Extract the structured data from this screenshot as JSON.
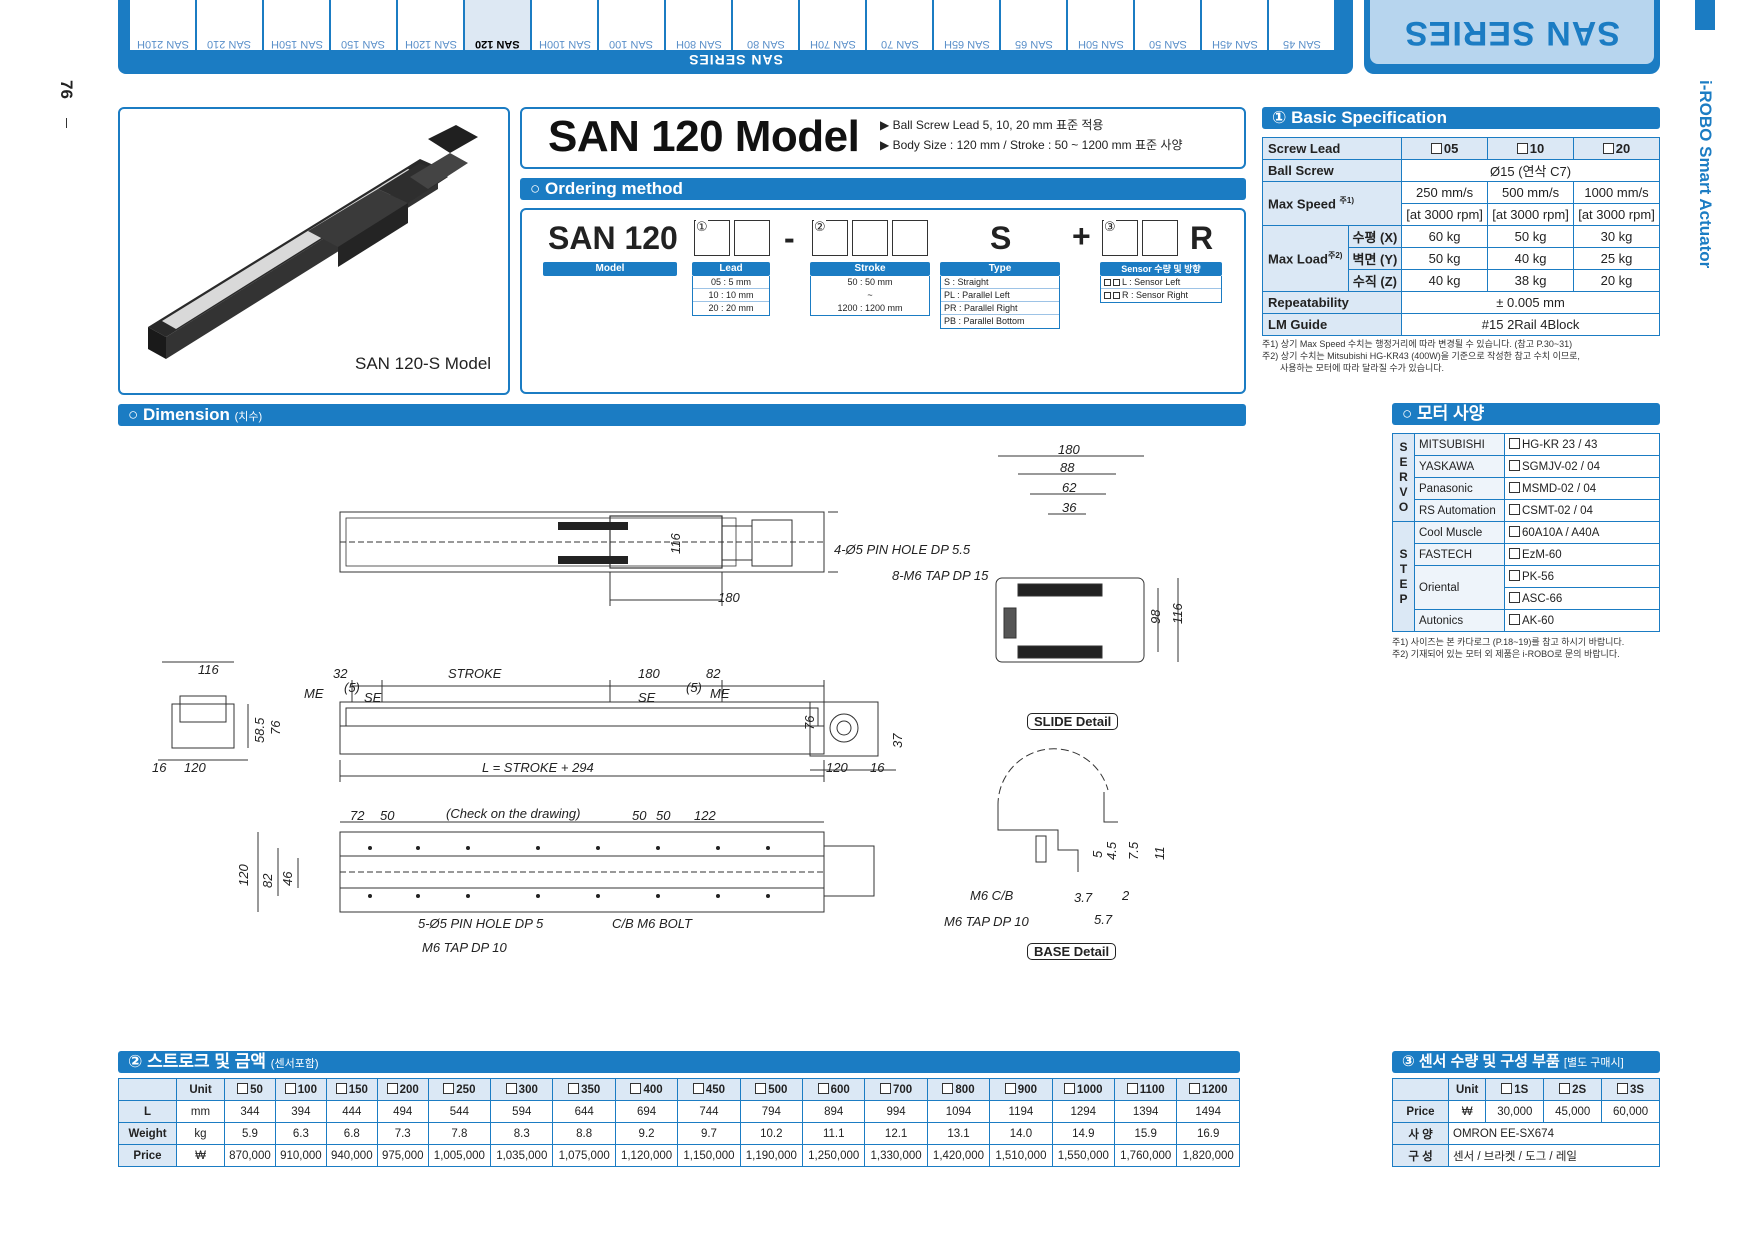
{
  "page_number": "76",
  "brand_vertical": "i-ROBO Smart Actuator",
  "series_box": "SAN SERIES",
  "top_tabs": {
    "label": "SAN SERIES",
    "items": [
      "SAN 210H",
      "SAN 210",
      "SAN 150H",
      "SAN 150",
      "SAN 120H",
      "SAN 120",
      "SAN 100H",
      "SAN 100",
      "SAN 80H",
      "SAN 80",
      "SAN 70H",
      "SAN 70",
      "SAN 65H",
      "SAN 65",
      "SAN 50H",
      "SAN 50",
      "SAN 45H",
      "SAN 45"
    ],
    "active_index": 5
  },
  "product_image_caption": "SAN 120-S Model",
  "model": {
    "title": "SAN 120 Model",
    "notes": [
      "▶ Ball Screw Lead 5, 10, 20 mm 표준 적용",
      "▶ Body Size : 120 mm / Stroke : 50 ~ 1200 mm 표준 사양"
    ]
  },
  "ordering": {
    "title": "○ Ordering method",
    "code": "SAN 120",
    "dash": "-",
    "type_letter": "S",
    "plus": "+",
    "suffix": "R",
    "circled": [
      "①",
      "②",
      "③"
    ],
    "labels": {
      "model": "Model",
      "lead": "Lead",
      "stroke": "Stroke",
      "type": "Type",
      "sensor": "Sensor 수량 및 방향"
    },
    "lead_options": [
      "05 : 5 mm",
      "10 : 10 mm",
      "20 : 20 mm"
    ],
    "stroke_options": [
      "50 : 50 mm",
      "~",
      "1200 : 1200 mm"
    ],
    "type_options": [
      "S : Straight",
      "PL : Parallel Left",
      "PR : Parallel Right",
      "PB : Parallel Bottom"
    ],
    "sensor_options": [
      "L : Sensor Left",
      "R : Sensor Right"
    ]
  },
  "basic_spec": {
    "title": "① Basic Specification",
    "rows": {
      "screw_lead": "Screw Lead",
      "leads": [
        "05",
        "10",
        "20"
      ],
      "ball_screw": "Ball Screw",
      "ball_screw_val": "Ø15 (연삭 C7)",
      "max_speed": "Max Speed",
      "max_speed_note": "주1)",
      "speeds": [
        "250 mm/s",
        "500 mm/s",
        "1000 mm/s"
      ],
      "rpm": [
        "[at 3000 rpm]",
        "[at 3000 rpm]",
        "[at 3000 rpm]"
      ],
      "max_load": "Max Load",
      "max_load_note": "주2)",
      "load_rows": [
        {
          "label": "수평 (X)",
          "vals": [
            "60 kg",
            "50 kg",
            "30 kg"
          ]
        },
        {
          "label": "벽면 (Y)",
          "vals": [
            "50 kg",
            "40 kg",
            "25 kg"
          ]
        },
        {
          "label": "수직 (Z)",
          "vals": [
            "40 kg",
            "38 kg",
            "20 kg"
          ]
        }
      ],
      "repeatability": "Repeatability",
      "repeatability_val": "± 0.005 mm",
      "lm_guide": "LM Guide",
      "lm_guide_val": "#15 2Rail 4Block"
    },
    "footnotes": [
      "주1) 상기 Max Speed 수치는 행정거리에 따라 변경될 수 있습니다. (참고 P.30~31)",
      "주2) 상기 수치는 Mitsubishi HG-KR43 (400W)을 기준으로 작성한 참고 수치 이므로,",
      "사용하는 모터에 따라 달라질 수가 있습니다."
    ]
  },
  "motor_spec": {
    "title": "○ 모터 사양",
    "servo_label": [
      "S",
      "E",
      "R",
      "V",
      "O"
    ],
    "step_label": [
      "S",
      "T",
      "E",
      "P"
    ],
    "servo": [
      {
        "maker": "MITSUBISHI",
        "model": "HG-KR 23 / 43"
      },
      {
        "maker": "YASKAWA",
        "model": "SGMJV-02 / 04"
      },
      {
        "maker": "Panasonic",
        "model": "MSMD-02 / 04"
      },
      {
        "maker": "RS Automation",
        "model": "CSMT-02 / 04"
      }
    ],
    "step": [
      {
        "maker": "Cool Muscle",
        "model": "60A10A / A40A"
      },
      {
        "maker": "FASTECH",
        "model": "EzM-60"
      },
      {
        "maker": "Oriental",
        "model": "PK-56"
      },
      {
        "maker": "",
        "model": "ASC-66"
      },
      {
        "maker": "Autonics",
        "model": "AK-60"
      }
    ],
    "footnotes": [
      "주1) 사이즈는 본 카다로그 (P.18~19)를 참고 하시기 바랍니다.",
      "주2) 기재되어 있는 모터 외 제품은 i-ROBO로 문의 바랍니다."
    ]
  },
  "dimension": {
    "title": "○ Dimension",
    "title_small": "(치수)",
    "labels": {
      "pin_hole_top": "4-Ø5 PIN HOLE DP 5.5",
      "tap_top": "8-M6 TAP DP 15",
      "stroke": "STROKE",
      "me": "ME",
      "se": "SE",
      "five": "(5)",
      "l_formula": "L = STROKE + 294",
      "check": "(Check on the drawing)",
      "pin_hole_bottom": "5-Ø5 PIN HOLE DP 5",
      "cb_bolt": "C/B M6 BOLT",
      "tap_bottom": "M6 TAP DP 10",
      "m6cb": "M6 C/B",
      "m6tap": "M6 TAP DP 10"
    },
    "numbers": {
      "top_116": "116",
      "top_180": "180",
      "side_32": "32",
      "side_180": "180",
      "side_82": "82",
      "end_116": "116",
      "end_76": "76",
      "end_58": "58.5",
      "end_16": "16",
      "end_120": "120",
      "end2_76": "76",
      "end2_37": "37",
      "end2_120": "120",
      "end2_16": "16",
      "slide_180": "180",
      "slide_88": "88",
      "slide_62": "62",
      "slide_36": "36",
      "slide_98": "98",
      "slide_116": "116",
      "bot_72": "72",
      "bot_50a": "50",
      "bot_50b": "50",
      "bot_50c": "50",
      "bot_122": "122",
      "bot_120": "120",
      "bot_82": "82",
      "bot_46": "46",
      "base_11": "11",
      "base_7": "7.5",
      "base_45": "4.5",
      "base_5": "5",
      "base_37": "3.7",
      "base_2": "2",
      "base_57": "5.7"
    },
    "slide_detail": "SLIDE Detail",
    "base_detail": "BASE Detail"
  },
  "price_table": {
    "title": "② 스트로크 및 금액",
    "title_small": "(센서포함)",
    "unit_header": "Unit",
    "strokes": [
      "50",
      "100",
      "150",
      "200",
      "250",
      "300",
      "350",
      "400",
      "450",
      "500",
      "600",
      "700",
      "800",
      "900",
      "1000",
      "1100",
      "1200"
    ],
    "rows": [
      {
        "label": "L",
        "unit": "mm",
        "vals": [
          "344",
          "394",
          "444",
          "494",
          "544",
          "594",
          "644",
          "694",
          "744",
          "794",
          "894",
          "994",
          "1094",
          "1194",
          "1294",
          "1394",
          "1494"
        ]
      },
      {
        "label": "Weight",
        "unit": "kg",
        "vals": [
          "5.9",
          "6.3",
          "6.8",
          "7.3",
          "7.8",
          "8.3",
          "8.8",
          "9.2",
          "9.7",
          "10.2",
          "11.1",
          "12.1",
          "13.1",
          "14.0",
          "14.9",
          "15.9",
          "16.9"
        ]
      },
      {
        "label": "Price",
        "unit": "₩",
        "vals": [
          "870,000",
          "910,000",
          "940,000",
          "975,000",
          "1,005,000",
          "1,035,000",
          "1,075,000",
          "1,120,000",
          "1,150,000",
          "1,190,000",
          "1,250,000",
          "1,330,000",
          "1,420,000",
          "1,510,000",
          "1,550,000",
          "1,760,000",
          "1,820,000"
        ]
      }
    ]
  },
  "sensor_table": {
    "title": "③ 센서 수량 및 구성 부품",
    "title_small": "[별도 구매시]",
    "unit_header": "Unit",
    "options": [
      "1S",
      "2S",
      "3S"
    ],
    "price_label": "Price",
    "price_unit": "₩",
    "prices": [
      "30,000",
      "45,000",
      "60,000"
    ],
    "spec_label": "사 양",
    "spec_val": "OMRON   EE-SX674",
    "comp_label": "구 성",
    "comp_val": "센서 / 브라켓 / 도그 / 레일"
  },
  "colors": {
    "accent": "#1b7cc3",
    "header_fill": "#dbe8f5"
  }
}
